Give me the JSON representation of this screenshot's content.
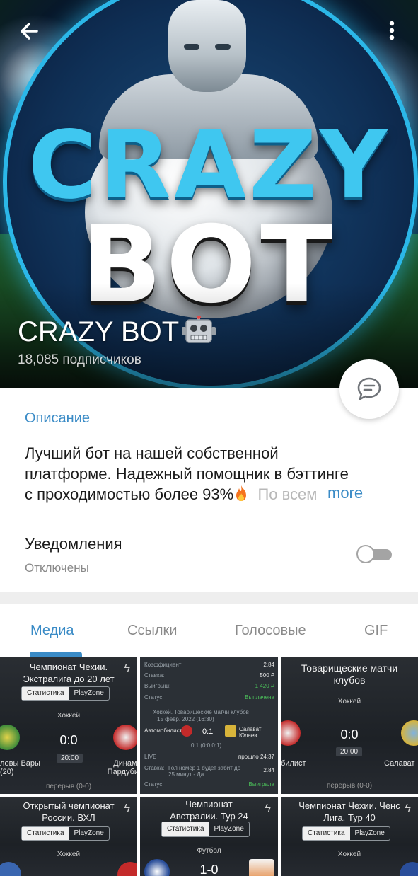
{
  "header": {
    "channel_title": "CRAZY BOT",
    "subscribers": "18,085 подписчиков",
    "banner_logo_line1": "CRAZY",
    "banner_logo_line2": "BOT"
  },
  "info": {
    "description_label": "Описание",
    "description_lines": [
      "Лучший бот на нашей собственной",
      "платформе. Надежный помощник в бэттинге",
      "с проходимостью более 93%"
    ],
    "description_tail": "По всем",
    "more_label": "more",
    "notifications_label": "Уведомления",
    "notifications_status": "Отключены"
  },
  "tabs": [
    {
      "label": "Медиа",
      "active": true
    },
    {
      "label": "Ссылки",
      "active": false
    },
    {
      "label": "Голосовые",
      "active": false
    },
    {
      "label": "GIF",
      "active": false
    }
  ],
  "media": {
    "tile1": {
      "title": "Чемпионат Чехии. Экстралига до 20 лет",
      "seg_stats": "Статистика",
      "seg_playzone": "PlayZone",
      "sport": "Хоккей",
      "score": "0:0",
      "clock": "20:00",
      "team_left": "ловы Вары (20)",
      "team_right": "Динамо Пардубице",
      "period": "перерыв (0-0)"
    },
    "tile2": {
      "rows": [
        {
          "label": "Коэффициент:",
          "value": "2.84"
        },
        {
          "label": "Ставка:",
          "value": "500 ₽"
        },
        {
          "label": "Выигрыш:",
          "value": "1 420 ₽"
        },
        {
          "label": "Статус:",
          "value": "Выплачена"
        }
      ],
      "event": "Хоккей. Товарищеские матчи клубов",
      "date": "15 февр. 2022 (16:30)",
      "team_left": "Автомобилист",
      "team_right": "Салават Юлаев",
      "score": "0:1",
      "periods": "0:1 (0:0,0:1)",
      "live_label": "LIVE",
      "live_time": "прошло 24:37",
      "bet_label": "Ставка:",
      "bet_text": "Гол номер 1 будет забит до 25 минут - Да",
      "bet_odds": "2.84",
      "status_label": "Статус:",
      "status_value": "Выиграла"
    },
    "tile3": {
      "title": "Товарищеские матчи клубов",
      "sport": "Хоккей",
      "score": "0:0",
      "clock": "20:00",
      "team_left": "билист",
      "team_right": "Салават",
      "period": "перерыв (0-0)"
    },
    "tile4": {
      "title": "Открытый чемпионат России. ВХЛ",
      "seg_stats": "Статистика",
      "seg_playzone": "PlayZone",
      "sport": "Хоккей"
    },
    "tile5": {
      "title": "Чемпионат Австралии. Тур 24",
      "seg_stats": "Статистика",
      "seg_playzone": "PlayZone",
      "sport": "Футбол",
      "score": "1-0"
    },
    "tile6": {
      "title": "Чемпионат Чехии. Ченс Лига. Тур 40",
      "seg_stats": "Статистика",
      "seg_playzone": "PlayZone",
      "sport": "Хоккей"
    }
  },
  "colors": {
    "accent": "#3a8bc6",
    "logo_cyan": "#3fc7f0",
    "divider": "#e6e6e6"
  },
  "icons": {
    "back": "arrow-left",
    "menu": "dots-vertical",
    "fab": "chat-bubble",
    "title_emoji": "robot-face",
    "description_emoji": "fire",
    "tile_badge": "lightning-bolt"
  }
}
